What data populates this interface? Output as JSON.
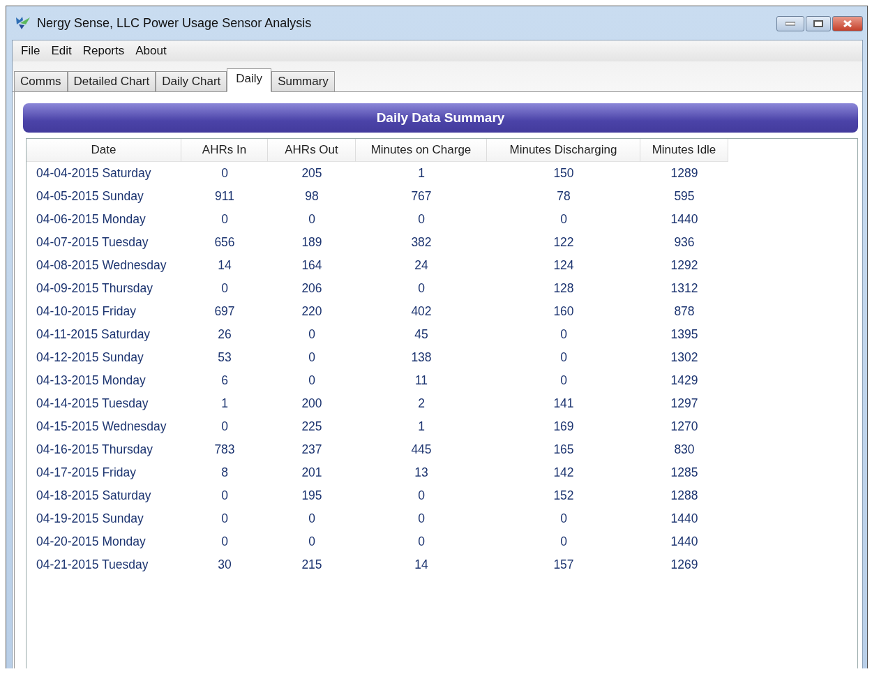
{
  "window": {
    "title": "Nergy Sense, LLC Power Usage Sensor Analysis"
  },
  "menu": [
    "File",
    "Edit",
    "Reports",
    "About"
  ],
  "tabs": [
    {
      "label": "Comms",
      "selected": false
    },
    {
      "label": "Detailed Chart",
      "selected": false
    },
    {
      "label": "Daily Chart",
      "selected": false
    },
    {
      "label": "Daily",
      "selected": true
    },
    {
      "label": "Summary",
      "selected": false
    }
  ],
  "panel_title": "Daily Data Summary",
  "table": {
    "columns": [
      "Date",
      "AHRs In",
      "AHRs Out",
      "Minutes on Charge",
      "Minutes Discharging",
      "Minutes Idle"
    ],
    "rows": [
      [
        "04-04-2015 Saturday",
        "0",
        "205",
        "1",
        "150",
        "1289"
      ],
      [
        "04-05-2015 Sunday",
        "911",
        "98",
        "767",
        "78",
        "595"
      ],
      [
        "04-06-2015 Monday",
        "0",
        "0",
        "0",
        "0",
        "1440"
      ],
      [
        "04-07-2015 Tuesday",
        "656",
        "189",
        "382",
        "122",
        "936"
      ],
      [
        "04-08-2015 Wednesday",
        "14",
        "164",
        "24",
        "124",
        "1292"
      ],
      [
        "04-09-2015 Thursday",
        "0",
        "206",
        "0",
        "128",
        "1312"
      ],
      [
        "04-10-2015 Friday",
        "697",
        "220",
        "402",
        "160",
        "878"
      ],
      [
        "04-11-2015 Saturday",
        "26",
        "0",
        "45",
        "0",
        "1395"
      ],
      [
        "04-12-2015 Sunday",
        "53",
        "0",
        "138",
        "0",
        "1302"
      ],
      [
        "04-13-2015 Monday",
        "6",
        "0",
        "11",
        "0",
        "1429"
      ],
      [
        "04-14-2015 Tuesday",
        "1",
        "200",
        "2",
        "141",
        "1297"
      ],
      [
        "04-15-2015 Wednesday",
        "0",
        "225",
        "1",
        "169",
        "1270"
      ],
      [
        "04-16-2015 Thursday",
        "783",
        "237",
        "445",
        "165",
        "830"
      ],
      [
        "04-17-2015 Friday",
        "8",
        "201",
        "13",
        "142",
        "1285"
      ],
      [
        "04-18-2015 Saturday",
        "0",
        "195",
        "0",
        "152",
        "1288"
      ],
      [
        "04-19-2015 Sunday",
        "0",
        "0",
        "0",
        "0",
        "1440"
      ],
      [
        "04-20-2015 Monday",
        "0",
        "0",
        "0",
        "0",
        "1440"
      ],
      [
        "04-21-2015 Tuesday",
        "30",
        "215",
        "14",
        "157",
        "1269"
      ]
    ]
  }
}
